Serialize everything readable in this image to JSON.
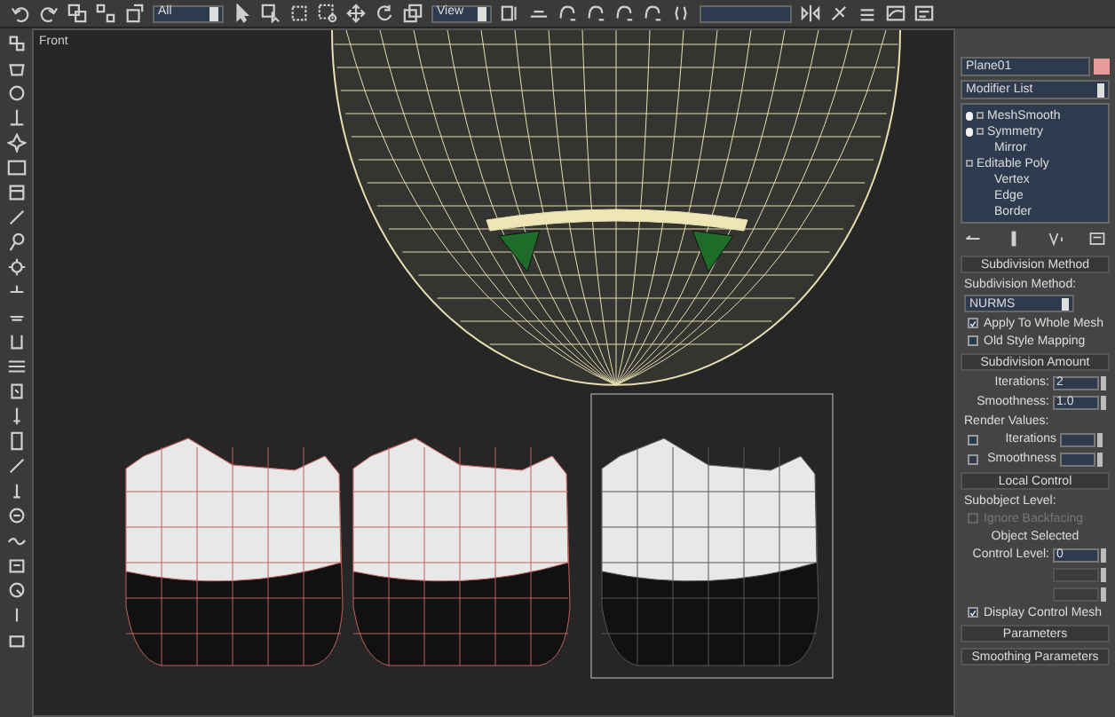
{
  "toolbar": {
    "selection_filter": "All",
    "reference_coord": "View"
  },
  "viewport": {
    "label": "Front"
  },
  "command_panel": {
    "object_name": "Plane01",
    "modifier_list": "Modifier List",
    "stack": [
      {
        "name": "MeshSmooth",
        "kind": "modifier",
        "on": true
      },
      {
        "name": "Symmetry",
        "kind": "modifier",
        "on": true,
        "children": [
          {
            "name": "Mirror"
          }
        ]
      },
      {
        "name": "Editable Poly",
        "kind": "base",
        "children": [
          {
            "name": "Vertex"
          },
          {
            "name": "Edge"
          },
          {
            "name": "Border"
          }
        ]
      }
    ],
    "rollouts": [
      {
        "title": "Subdivision Method",
        "controls": [
          {
            "kind": "label",
            "text": "Subdivision Method:"
          },
          {
            "kind": "dropdown",
            "value": "NURMS"
          },
          {
            "kind": "checkbox",
            "label": "Apply To Whole Mesh",
            "checked": true
          },
          {
            "kind": "checkbox",
            "label": "Old Style Mapping",
            "checked": false
          }
        ]
      },
      {
        "title": "Subdivision Amount",
        "controls": [
          {
            "kind": "spinner",
            "label": "Iterations:",
            "value": "2",
            "disabled": false
          },
          {
            "kind": "spinner",
            "label": "Smoothness:",
            "value": "1.0",
            "disabled": false
          },
          {
            "kind": "label",
            "text": "Render Values:"
          },
          {
            "kind": "checkspinner",
            "label": "Iterations",
            "checked": false
          },
          {
            "kind": "checkspinner",
            "label": "Smoothness",
            "checked": false
          }
        ]
      },
      {
        "title": "Local Control",
        "controls": [
          {
            "kind": "label",
            "text": "Subobject Level:"
          },
          {
            "kind": "checkbox",
            "label": "Ignore Backfacing",
            "checked": false,
            "disabled": true
          },
          {
            "kind": "center",
            "text": "Object Selected"
          },
          {
            "kind": "spinner",
            "label": "Control Level:",
            "value": "0",
            "disabled": false
          },
          {
            "kind": "spinner",
            "disabled": true
          },
          {
            "kind": "spinner",
            "disabled": true
          },
          {
            "kind": "checkbox",
            "label": "Display Control Mesh",
            "checked": true
          }
        ]
      },
      {
        "title": "Parameters"
      },
      {
        "title": "Smoothing Parameters"
      }
    ]
  }
}
